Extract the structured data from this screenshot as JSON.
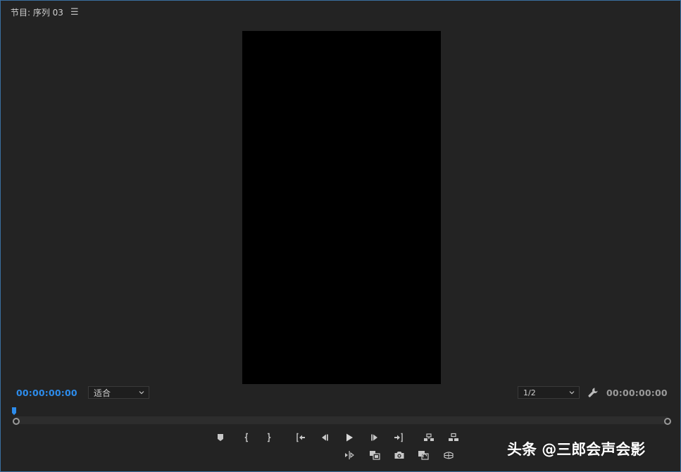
{
  "panel": {
    "title": "节目: 序列 03",
    "menu_icon": "☰"
  },
  "timecode": {
    "current": "00:00:00:00",
    "duration": "00:00:00:00"
  },
  "zoom": {
    "selected": "适合"
  },
  "resolution": {
    "selected": "1/2"
  },
  "transport_row1": [
    "add-marker",
    "mark-in",
    "mark-out",
    "go-to-in",
    "step-back",
    "play",
    "step-forward",
    "go-to-out",
    "lift",
    "extract"
  ],
  "transport_row2": [
    "trim-monitor",
    "comparison-view",
    "export-frame",
    "insert-overwrite",
    "vr-video"
  ],
  "colors": {
    "accent": "#2d8ceb",
    "panel_bg": "#232323",
    "border": "#3a6fa0"
  },
  "watermark": "头条 @三郎会声会影"
}
